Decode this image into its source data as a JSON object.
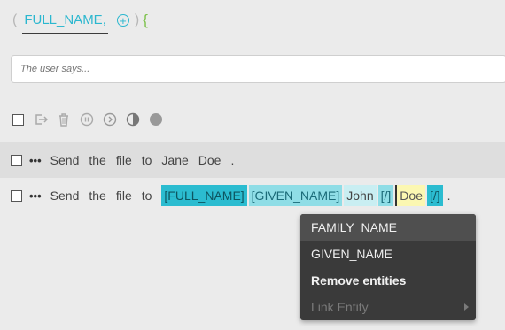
{
  "header": {
    "open_paren": "(",
    "entity_tag": "FULL_NAME,",
    "close_paren": ")",
    "open_brace": "{",
    "add_icon": "plus-circle-icon"
  },
  "input": {
    "placeholder": "The user says..."
  },
  "toolbar": {
    "icons": [
      "checkbox",
      "export-icon",
      "trash-icon",
      "pause-icon",
      "chevron-right-circle-icon",
      "contrast-icon",
      "circle-icon"
    ]
  },
  "examples": [
    {
      "words": [
        "Send",
        "the",
        "file",
        "to",
        "Jane",
        "Doe",
        "."
      ]
    },
    {
      "words": [
        "Send",
        "the",
        "file",
        "to"
      ],
      "tokens": [
        "[FULL_NAME]",
        "[GIVEN_NAME]",
        "John",
        "[/]",
        "Doe",
        "[/]"
      ],
      "end": "."
    }
  ],
  "context_menu": {
    "items": [
      "FAMILY_NAME",
      "GIVEN_NAME",
      "Remove entities",
      "Link Entity"
    ]
  },
  "colors": {
    "accent": "#2bb7cf",
    "brace": "#7cc14a",
    "highlight_full": "#2bbcd0",
    "highlight_given": "#8fdde6",
    "highlight_doe": "#fbf7b2",
    "menu_bg": "#3a3a3a"
  }
}
